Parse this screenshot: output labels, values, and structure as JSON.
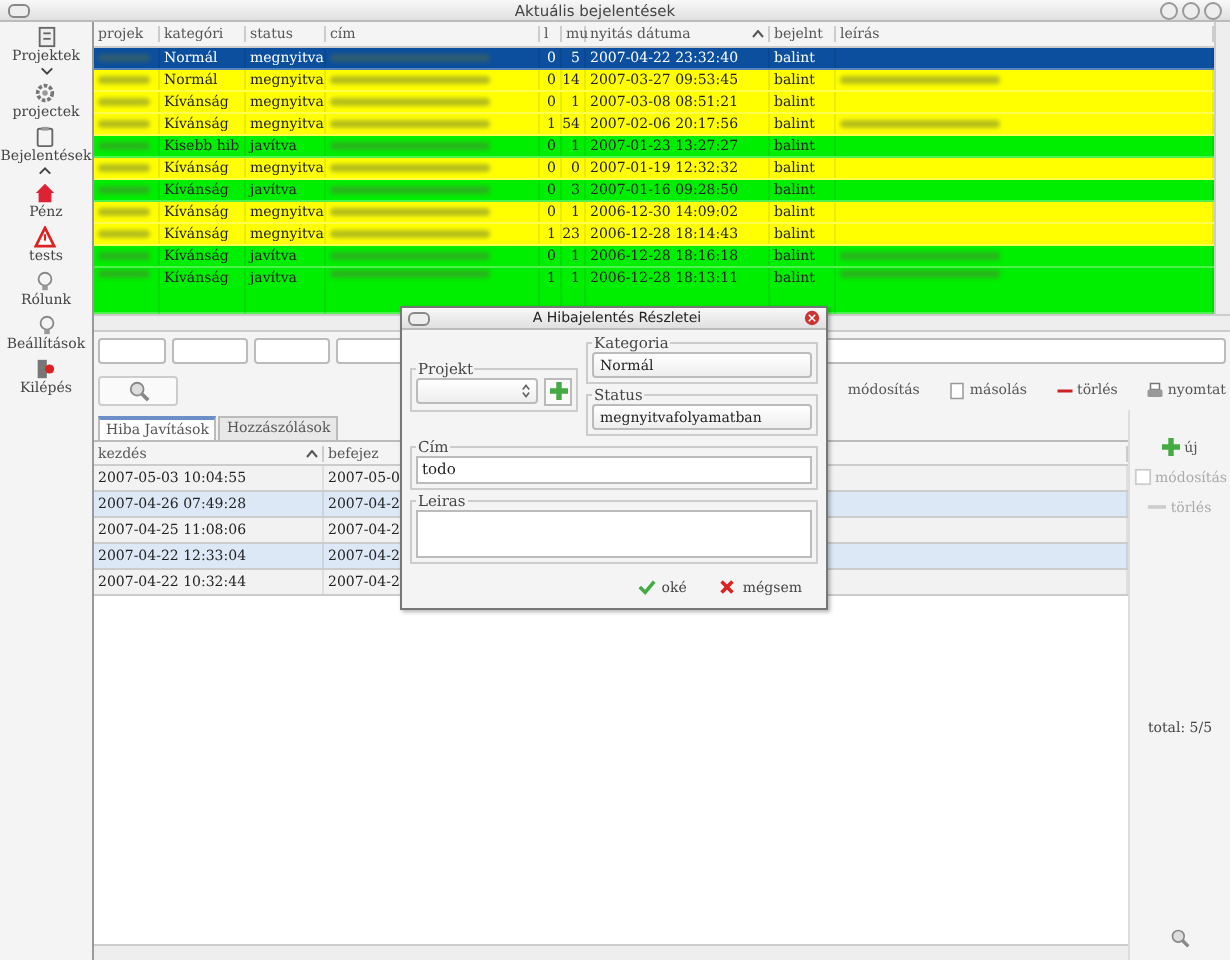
{
  "window": {
    "title": "Aktuális bejelentések"
  },
  "sidebar": {
    "items": [
      {
        "label": "Projektek"
      },
      {
        "label": "projectek"
      },
      {
        "label": "Bejelentések"
      },
      {
        "label": "Pénz"
      },
      {
        "label": "tests"
      },
      {
        "label": "Rólunk"
      },
      {
        "label": "Beállítások"
      },
      {
        "label": "Kilépés"
      }
    ]
  },
  "table": {
    "columns": [
      "projek",
      "kategóri",
      "status",
      "cím",
      "l",
      "mu",
      "nyitás dátuma",
      "bejelnt",
      "leírás"
    ],
    "rows": [
      {
        "selected": true,
        "color": "#0b4f9e",
        "kategoria": "Normál",
        "status": "megnyitva",
        "l": "0",
        "mu": "5",
        "date": "2007-04-22 23:32:40",
        "bejelnt": "balint",
        "leiras_blurred": false
      },
      {
        "selected": false,
        "color": "#ffff00",
        "kategoria": "Normál",
        "status": "megnyitva",
        "l": "0",
        "mu": "14",
        "date": "2007-03-27 09:53:45",
        "bejelnt": "balint",
        "leiras_blurred": true
      },
      {
        "selected": false,
        "color": "#ffff00",
        "kategoria": "Kívánság",
        "status": "megnyitva",
        "l": "0",
        "mu": "1",
        "date": "2007-03-08 08:51:21",
        "bejelnt": "balint",
        "leiras_blurred": false
      },
      {
        "selected": false,
        "color": "#ffff00",
        "kategoria": "Kívánság",
        "status": "megnyitva",
        "l": "1",
        "mu": "54",
        "date": "2007-02-06 20:17:56",
        "bejelnt": "balint",
        "leiras_blurred": true
      },
      {
        "selected": false,
        "color": "#00ee00",
        "kategoria": "Kisebb hib",
        "status": "javítva",
        "l": "0",
        "mu": "1",
        "date": "2007-01-23 13:27:27",
        "bejelnt": "balint",
        "leiras_blurred": false
      },
      {
        "selected": false,
        "color": "#ffff00",
        "kategoria": "Kívánság",
        "status": "megnyitva",
        "l": "0",
        "mu": "0",
        "date": "2007-01-19 12:32:32",
        "bejelnt": "balint",
        "leiras_blurred": false
      },
      {
        "selected": false,
        "color": "#00ee00",
        "kategoria": "Kívánság",
        "status": "javítva",
        "l": "0",
        "mu": "3",
        "date": "2007-01-16 09:28:50",
        "bejelnt": "balint",
        "leiras_blurred": false
      },
      {
        "selected": false,
        "color": "#ffff00",
        "kategoria": "Kívánság",
        "status": "megnyitva",
        "l": "0",
        "mu": "1",
        "date": "2006-12-30 14:09:02",
        "bejelnt": "balint",
        "leiras_blurred": false
      },
      {
        "selected": false,
        "color": "#ffff00",
        "kategoria": "Kívánság",
        "status": "megnyitva",
        "l": "1",
        "mu": "23",
        "date": "2006-12-28 18:14:43",
        "bejelnt": "balint",
        "leiras_blurred": false
      },
      {
        "selected": false,
        "color": "#00ee00",
        "kategoria": "Kívánság",
        "status": "javítva",
        "l": "0",
        "mu": "1",
        "date": "2006-12-28 18:16:18",
        "bejelnt": "balint",
        "leiras_blurred": true
      },
      {
        "selected": false,
        "color": "#00ee00",
        "kategoria": "Kívánság",
        "status": "javítva",
        "l": "1",
        "mu": "1",
        "date": "2006-12-28 18:13:11",
        "bejelnt": "balint",
        "leiras_blurred": true
      }
    ]
  },
  "toolbar": [
    {
      "label": "módosítás"
    },
    {
      "label": "másolás"
    },
    {
      "label": "törlés"
    },
    {
      "label": "nyomtat"
    }
  ],
  "tabs": [
    {
      "label": "Hiba Javítások",
      "selected": true
    },
    {
      "label": "Hozzászólások",
      "selected": false
    }
  ],
  "sub_table": {
    "columns": [
      "kezdés",
      "befejez"
    ],
    "rows": [
      {
        "kezdes": "2007-05-03 10:04:55",
        "befejez": "2007-05-0",
        "selected": false
      },
      {
        "kezdes": "2007-04-26 07:49:28",
        "befejez": "2007-04-2",
        "selected": true
      },
      {
        "kezdes": "2007-04-25 11:08:06",
        "befejez": "2007-04-2",
        "selected": false
      },
      {
        "kezdes": "2007-04-22 12:33:04",
        "befejez": "2007-04-2",
        "selected": true
      },
      {
        "kezdes": "2007-04-22 10:32:44",
        "befejez": "2007-04-2",
        "selected": false
      }
    ]
  },
  "side_buttons": [
    {
      "label": "új",
      "disabled": false
    },
    {
      "label": "módosítás",
      "disabled": true
    },
    {
      "label": "törlés",
      "disabled": true
    }
  ],
  "total": "total: 5/5",
  "dialog": {
    "title": "A Hibajelentés Részletei",
    "projekt_label": "Projekt",
    "kategoria_label": "Kategoria",
    "kategoria": "Normál",
    "status_label": "Status",
    "status": "megnyitvafolyamatban",
    "cim_label": "Cím",
    "cim": "todo",
    "leiras_label": "Leiras",
    "ok": "oké",
    "cancel": "mégsem"
  }
}
